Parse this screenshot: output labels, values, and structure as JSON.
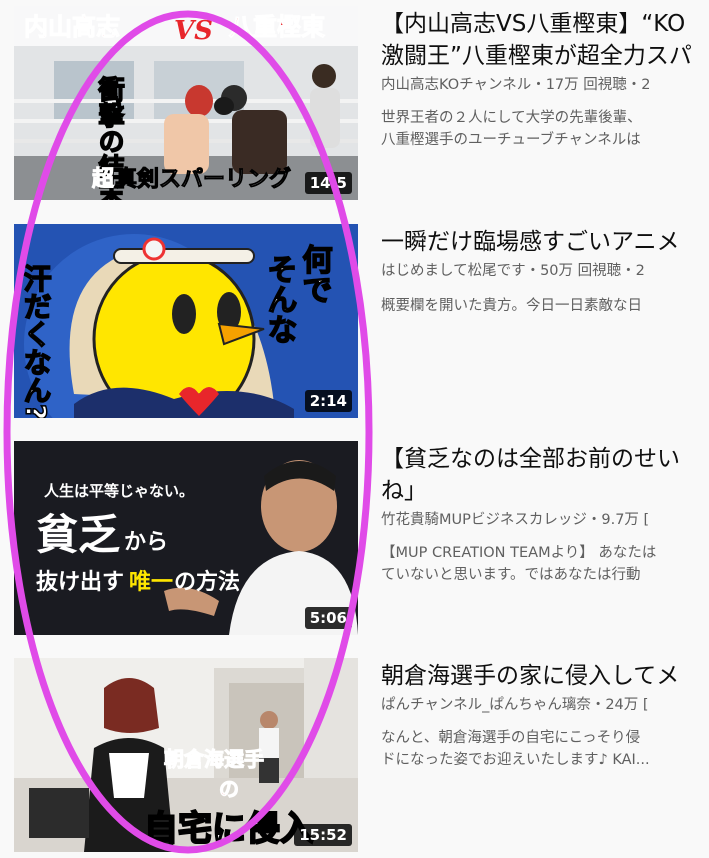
{
  "videos": [
    {
      "title_line1": "【内山高志VS八重樫東】“KO",
      "title_line2": "激闘王”八重樫東が超全力スパ",
      "channel_meta": "内山高志KOチャンネル・17万 回視聴・2",
      "desc_line1": "世界王者の２人にして大学の先輩後輩、",
      "desc_line2": "八重樫選手のユーチューブチャンネルは",
      "duration": "14:5",
      "thumb_text": {
        "top_left": "内山高志",
        "vs": "VS",
        "top_right": "八重樫東",
        "vertical": "衝撃の結末",
        "bottom_prefix": "超",
        "bottom": "真剣スパーリング"
      }
    },
    {
      "title_line1": "一瞬だけ臨場感すごいアニメ",
      "channel_meta": "はじめまして松尾です・50万 回視聴・2",
      "desc_line1": "概要欄を開いた貴方。今日一日素敵な日",
      "duration": "2:14",
      "thumb_text": {
        "col_right_1": "何で",
        "col_right_2": "そんな",
        "col_left": "汗だくなん?"
      }
    },
    {
      "title_line1": "【貧乏なのは全部お前のせい",
      "title_line2": "ね」",
      "channel_meta": "竹花貴騎MUPビジネスカレッジ・9.7万 [",
      "desc_line1": "【MUP CREATION TEAMより】 あなたは",
      "desc_line2": "ていないと思います。ではあなたは行動",
      "duration": "5:06",
      "thumb_text": {
        "line1": "人生は平等じゃない。",
        "line2_big": "貧乏",
        "line2_small": "から",
        "line3_a": "抜け出す",
        "line3_b": "唯一",
        "line3_c": "の方法"
      }
    },
    {
      "title_line1": "朝倉海選手の家に侵入してメ",
      "channel_meta": "ぱんチャンネル_ぱんちゃん璃奈・24万 [",
      "desc_line1": "なんと、朝倉海選手の自宅にこっそり侵",
      "desc_line2": "ドになった姿でお迎えいたします♪ KAI...",
      "duration": "15:52",
      "thumb_text": {
        "small": "朝倉海選手",
        "of": "の",
        "big": "自宅に侵入"
      }
    }
  ],
  "colors": {
    "background": "#f9f9f9",
    "annotation_ellipse": "#e04be8",
    "thumb_red": "#e8262b",
    "thumb_yellow": "#ffe600",
    "thumb_blue": "#2453b3"
  }
}
